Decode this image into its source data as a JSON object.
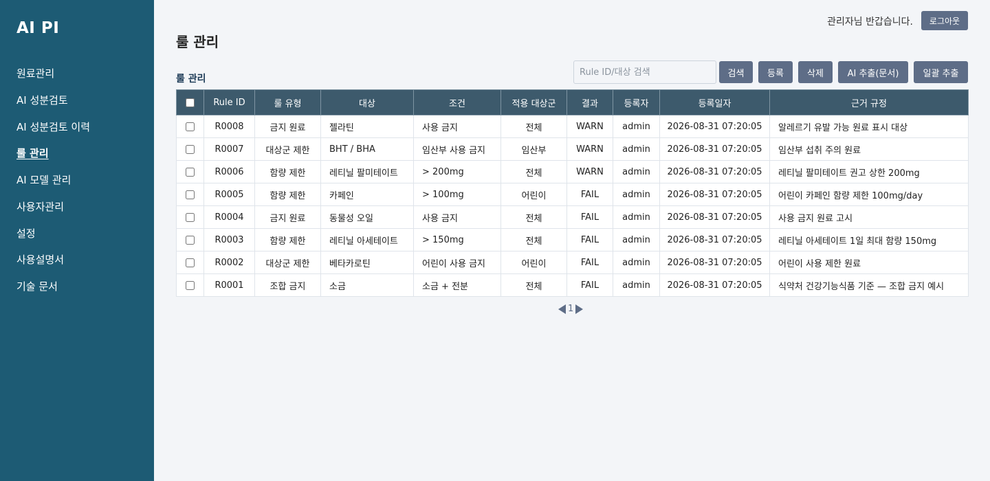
{
  "sidebar": {
    "brand": "AI PI",
    "items": [
      {
        "label": "원료관리"
      },
      {
        "label": "AI 성분검토"
      },
      {
        "label": "AI 성분검토 이력"
      },
      {
        "label": "룰 관리",
        "active": true
      },
      {
        "label": "AI 모델 관리"
      },
      {
        "label": "사용자관리"
      },
      {
        "label": "설정"
      },
      {
        "label": "사용설명서"
      },
      {
        "label": "기술 문서"
      }
    ]
  },
  "header": {
    "greeting": "관리자님 반갑습니다.",
    "logout_label": "로그아웃"
  },
  "page": {
    "title": "룰 관리",
    "section_title": "룰 관리"
  },
  "toolbar": {
    "search_placeholder": "Rule ID/대상 검색",
    "search_value": "",
    "search_label": "검색",
    "register_label": "등록",
    "delete_label": "삭제",
    "ai_extract_label": "AI 추출(문서)",
    "bulk_extract_label": "일괄 추출"
  },
  "table": {
    "columns": [
      "Rule ID",
      "룰 유형",
      "대상",
      "조건",
      "적용 대상군",
      "결과",
      "등록자",
      "등록일자",
      "근거 규정"
    ],
    "rows": [
      {
        "id": "R0008",
        "type": "금지 원료",
        "target": "젤라틴",
        "condition": "사용 금지",
        "group": "전체",
        "result": "WARN",
        "author": "admin",
        "date": "2026-08-31 07:20:05",
        "basis": "알레르기 유발 가능 원료 표시 대상"
      },
      {
        "id": "R0007",
        "type": "대상군 제한",
        "target": "BHT / BHA",
        "condition": "임산부 사용 금지",
        "group": "임산부",
        "result": "WARN",
        "author": "admin",
        "date": "2026-08-31 07:20:05",
        "basis": "임산부 섭취 주의 원료"
      },
      {
        "id": "R0006",
        "type": "함량 제한",
        "target": "레티닐 팔미테이트",
        "condition": "> 200mg",
        "group": "전체",
        "result": "WARN",
        "author": "admin",
        "date": "2026-08-31 07:20:05",
        "basis": "레티닐 팔미테이트 권고 상한 200mg"
      },
      {
        "id": "R0005",
        "type": "함량 제한",
        "target": "카페인",
        "condition": "> 100mg",
        "group": "어린이",
        "result": "FAIL",
        "author": "admin",
        "date": "2026-08-31 07:20:05",
        "basis": "어린이 카페인 함량 제한 100mg/day"
      },
      {
        "id": "R0004",
        "type": "금지 원료",
        "target": "동물성 오일",
        "condition": "사용 금지",
        "group": "전체",
        "result": "FAIL",
        "author": "admin",
        "date": "2026-08-31 07:20:05",
        "basis": "사용 금지 원료 고시"
      },
      {
        "id": "R0003",
        "type": "함량 제한",
        "target": "레티닐 아세테이트",
        "condition": "> 150mg",
        "group": "전체",
        "result": "FAIL",
        "author": "admin",
        "date": "2026-08-31 07:20:05",
        "basis": "레티닐 아세테이트 1일 최대 함량 150mg"
      },
      {
        "id": "R0002",
        "type": "대상군 제한",
        "target": "베타카로틴",
        "condition": "어린이 사용 금지",
        "group": "어린이",
        "result": "FAIL",
        "author": "admin",
        "date": "2026-08-31 07:20:05",
        "basis": "어린이 사용 제한 원료"
      },
      {
        "id": "R0001",
        "type": "조합 금지",
        "target": "소금",
        "condition": "소금 + 전분",
        "group": "전체",
        "result": "FAIL",
        "author": "admin",
        "date": "2026-08-31 07:20:05",
        "basis": "식약처 건강기능식품 기준 — 조합 금지 예시"
      }
    ]
  },
  "pagination": {
    "current_page": "1",
    "prev_icon": "triangle-left-icon",
    "next_icon": "triangle-right-icon"
  }
}
